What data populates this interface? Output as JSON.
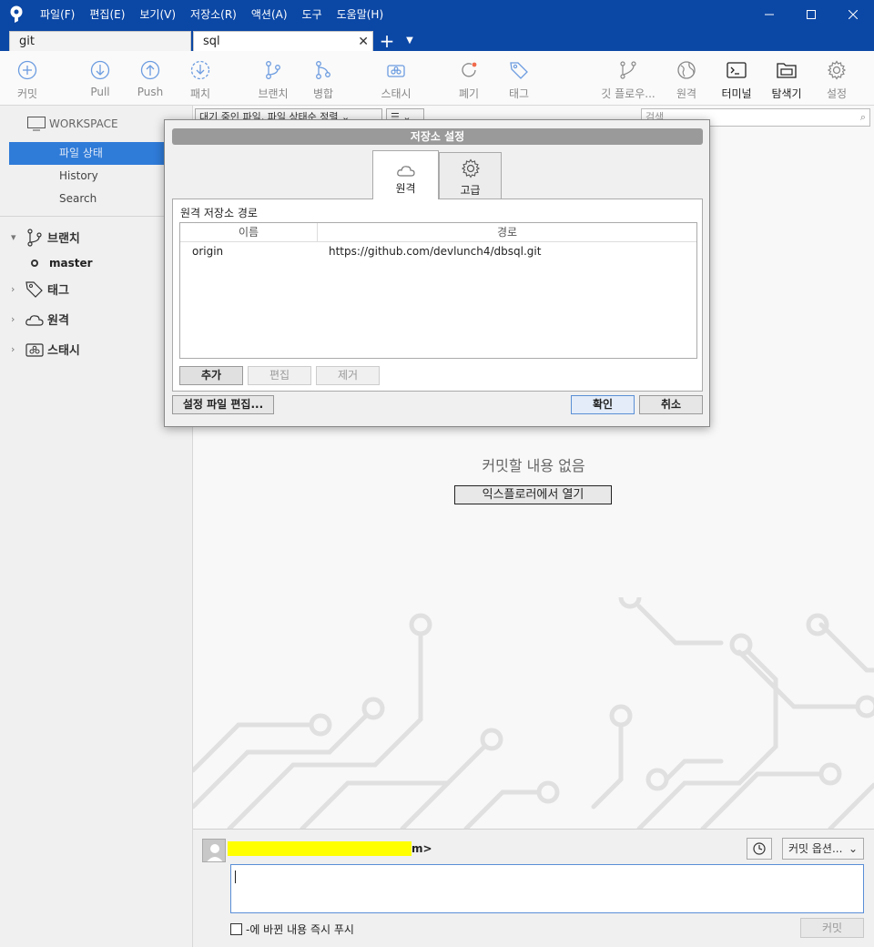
{
  "menu": [
    "파일(F)",
    "편집(E)",
    "보기(V)",
    "저장소(R)",
    "액션(A)",
    "도구",
    "도움말(H)"
  ],
  "tabs": [
    {
      "label": "git",
      "active": false
    },
    {
      "label": "sql",
      "active": true
    }
  ],
  "toolbar": {
    "commit": "커밋",
    "pull": "Pull",
    "push": "Push",
    "patch": "패치",
    "branch": "브랜치",
    "merge": "병합",
    "stash": "스태시",
    "discard": "폐기",
    "tag": "태그",
    "git_flow": "깃 플로우...",
    "remote": "원격",
    "terminal": "터미널",
    "explorer": "탐색기",
    "settings": "설정"
  },
  "sidebar": {
    "workspace": "WORKSPACE",
    "items": [
      "파일 상태",
      "History",
      "Search"
    ],
    "selected": "파일 상태",
    "branches_label": "브랜치",
    "current_branch": "master",
    "tags_label": "태그",
    "remotes_label": "원격",
    "stashes_label": "스태시"
  },
  "main": {
    "filter": "대기 중인 파일, 파일 상태순 정렬",
    "view_toggle": "☰",
    "search_placeholder": "검색",
    "empty_message": "커밋할 내용 없음",
    "open_explorer": "익스플로러에서 열기"
  },
  "commit_area": {
    "author_suffix": "m>",
    "options": "커밋 옵션...",
    "push_label": "-에 바뀐 내용 즉시 푸시",
    "commit_button": "커밋"
  },
  "dialog": {
    "title": "저장소 설정",
    "tab_remote": "원격",
    "tab_advanced": "고급",
    "heading": "원격 저장소 경로",
    "col_name": "이름",
    "col_path": "경로",
    "rows": [
      {
        "name": "origin",
        "path": "https://github.com/devlunch4/dbsql.git"
      }
    ],
    "add": "추가",
    "edit": "편집",
    "remove": "제거",
    "edit_config": "설정 파일 편집...",
    "ok": "확인",
    "cancel": "취소"
  },
  "colors": {
    "titlebar": "#0b47a5",
    "selection": "#2f7bd8",
    "highlight": "#ffff00"
  }
}
